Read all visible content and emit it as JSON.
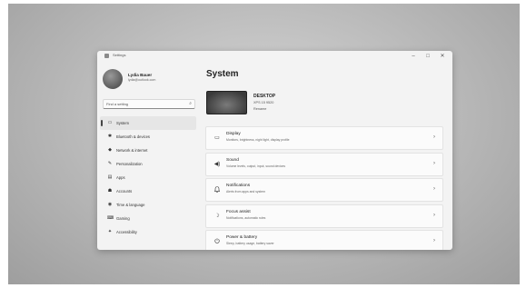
{
  "window": {
    "title": "Settings",
    "controls": {
      "minimize": "–",
      "maximize": "□",
      "close": "✕"
    }
  },
  "profile": {
    "name": "Lydia Bauer",
    "email": "lydia@outlook.com"
  },
  "search": {
    "placeholder": "Find a setting",
    "icon": "search-icon"
  },
  "nav": {
    "items": [
      {
        "label": "System",
        "icon": "monitor-icon",
        "glyph": "▭",
        "active": true
      },
      {
        "label": "Bluetooth & devices",
        "icon": "bluetooth-icon",
        "glyph": "✱",
        "active": false
      },
      {
        "label": "Network & internet",
        "icon": "wifi-icon",
        "glyph": "◆",
        "active": false
      },
      {
        "label": "Personalization",
        "icon": "brush-icon",
        "glyph": "✎",
        "active": false
      },
      {
        "label": "Apps",
        "icon": "apps-icon",
        "glyph": "▤",
        "active": false
      },
      {
        "label": "Accounts",
        "icon": "person-icon",
        "glyph": "☗",
        "active": false
      },
      {
        "label": "Time & language",
        "icon": "globe-icon",
        "glyph": "◉",
        "active": false
      },
      {
        "label": "Gaming",
        "icon": "gamepad-icon",
        "glyph": "⌨",
        "active": false
      },
      {
        "label": "Accessibility",
        "icon": "accessibility-icon",
        "glyph": "✦",
        "active": false
      }
    ]
  },
  "main": {
    "title": "System",
    "device": {
      "name": "DESKTOP",
      "model": "XPS 15 9520",
      "rename": "Rename"
    },
    "cards": [
      {
        "title": "Display",
        "desc": "Monitors, brightness, night light, display profile",
        "icon": "display-icon",
        "glyph": "▭"
      },
      {
        "title": "Sound",
        "desc": "Volume levels, output, input, sound devices",
        "icon": "speaker-icon",
        "glyph": "◀)"
      },
      {
        "title": "Notifications",
        "desc": "Alerts from apps and system",
        "icon": "bell-icon",
        "glyph": "🔔"
      },
      {
        "title": "Focus assist",
        "desc": "Notifications, automatic rules",
        "icon": "moon-icon",
        "glyph": "☽"
      },
      {
        "title": "Power & battery",
        "desc": "Sleep, battery usage, battery saver",
        "icon": "power-icon",
        "glyph": "⏻"
      }
    ],
    "chevron": "›"
  }
}
